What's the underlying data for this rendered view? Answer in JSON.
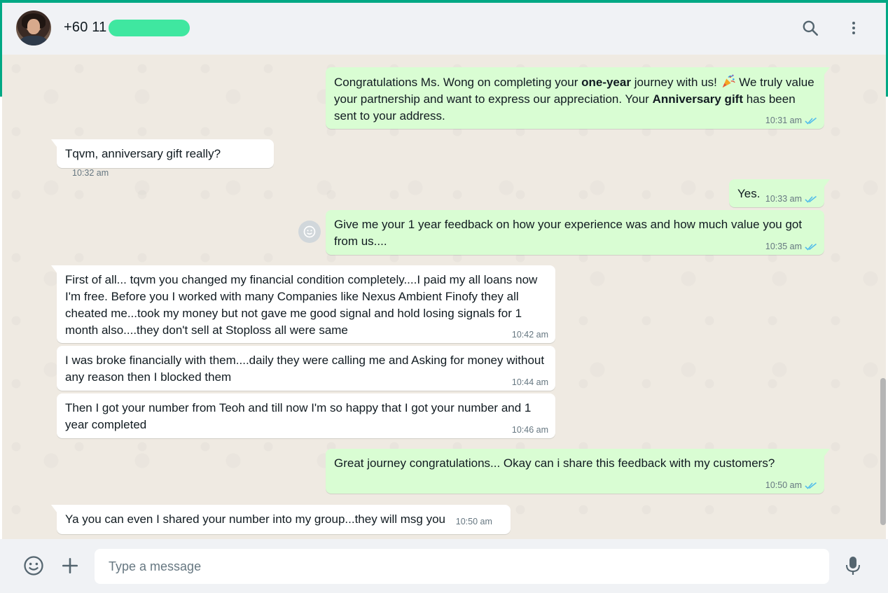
{
  "colors": {
    "accent": "#00a884",
    "outgoing_bubble": "#d9fdd3",
    "incoming_bubble": "#ffffff",
    "chat_background": "#efeae2",
    "read_ticks": "#53bdeb",
    "redaction": "#3fe7a0"
  },
  "header": {
    "contact_name": "+60 11",
    "avatar_icon": "avatar-photo",
    "search_icon": "search-icon",
    "menu_icon": "kebab-menu-icon"
  },
  "messages": [
    {
      "direction": "out",
      "parts": {
        "p1": "Congratulations Ms. Wong on completing your ",
        "b1": "one-year",
        "p2": " journey with us! ",
        "p3": " We truly value your partnership and want to express our appreciation. Your ",
        "b2": "Anniversary gift",
        "p4": " has been sent to your address."
      },
      "emoji": "party-popper-emoji",
      "time": "10:31 am",
      "status": "read"
    },
    {
      "direction": "in",
      "text": "Tqvm, anniversary gift really?",
      "time": "10:32 am"
    },
    {
      "direction": "out",
      "text": "Yes.",
      "time": "10:33 am",
      "status": "read"
    },
    {
      "direction": "out",
      "text": "Give me your 1 year feedback on how your experience was and how much value you got from us....",
      "time": "10:35 am",
      "status": "read"
    },
    {
      "direction": "in",
      "text": "First of all... tqvm you  changed my financial condition completely....I paid my all loans now I'm free. Before you I worked with  many Companies like Nexus Ambient Finofy they all cheated me...took my money but not gave me good signal and hold losing signals for 1 month also....they don't sell at Stoploss all were same",
      "time": "10:42 am"
    },
    {
      "direction": "in",
      "text": "I was broke financially with them....daily they were calling me and Asking for money without any reason then I blocked them",
      "time": "10:44 am"
    },
    {
      "direction": "in",
      "text": "Then I got your number from Teoh and till now I'm so happy that I got your number and 1 year completed",
      "time": "10:46 am"
    },
    {
      "direction": "out",
      "text": "Great journey congratulations... Okay can i share this feedback with my customers?",
      "time": "10:50 am",
      "status": "read"
    },
    {
      "direction": "in",
      "text": "Ya you can even I shared your number into my group...they will msg you",
      "time": "10:50 am"
    }
  ],
  "composer": {
    "placeholder": "Type a message",
    "value": "",
    "emoji_icon": "emoji-icon",
    "attach_icon": "plus-icon",
    "mic_icon": "microphone-icon"
  }
}
